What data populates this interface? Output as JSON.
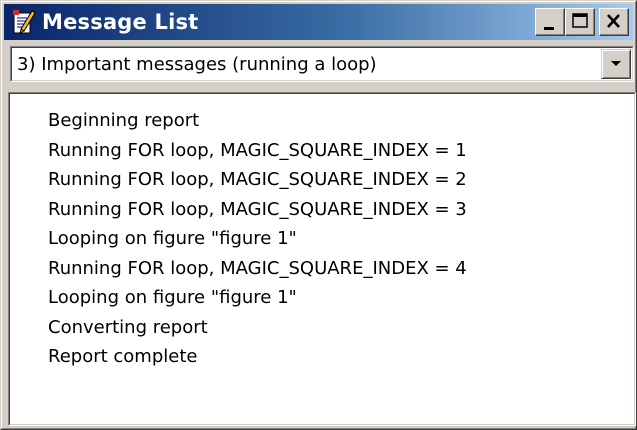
{
  "window": {
    "title": "Message List",
    "icon": "notepad-pencil-icon",
    "controls": [
      "minimize-icon",
      "maximize-icon",
      "close-icon"
    ]
  },
  "filter": {
    "selected": "3) Important messages (running a loop)"
  },
  "messages": [
    "Beginning report",
    "Running FOR loop, MAGIC_SQUARE_INDEX = 1",
    "Running FOR loop, MAGIC_SQUARE_INDEX = 2",
    "Running FOR loop, MAGIC_SQUARE_INDEX = 3",
    "Looping on figure \"figure 1\"",
    "Running FOR loop, MAGIC_SQUARE_INDEX = 4",
    "Looping on figure \"figure 1\"",
    "Converting report",
    "Report complete"
  ],
  "colors": {
    "titlebar_start": "#0a246a",
    "titlebar_end": "#a6caf0",
    "face": "#d4d0c8"
  }
}
